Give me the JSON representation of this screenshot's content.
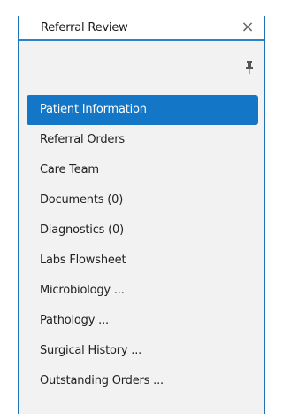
{
  "panel": {
    "title": "Referral Review",
    "close_icon": "close-icon",
    "close_glyph": "×",
    "pin_icon": "pin-icon"
  },
  "colors": {
    "accent": "#1376c6",
    "border": "#1f74b6",
    "panel_background": "#f2f2f2"
  },
  "nav": {
    "active_index": 0,
    "items": [
      {
        "label": "Patient Information"
      },
      {
        "label": "Referral Orders"
      },
      {
        "label": "Care Team"
      },
      {
        "label": "Documents (0)"
      },
      {
        "label": "Diagnostics (0)"
      },
      {
        "label": "Labs Flowsheet"
      },
      {
        "label": "Microbiology ..."
      },
      {
        "label": "Pathology ..."
      },
      {
        "label": "Surgical History ..."
      },
      {
        "label": "Outstanding Orders ..."
      }
    ]
  }
}
